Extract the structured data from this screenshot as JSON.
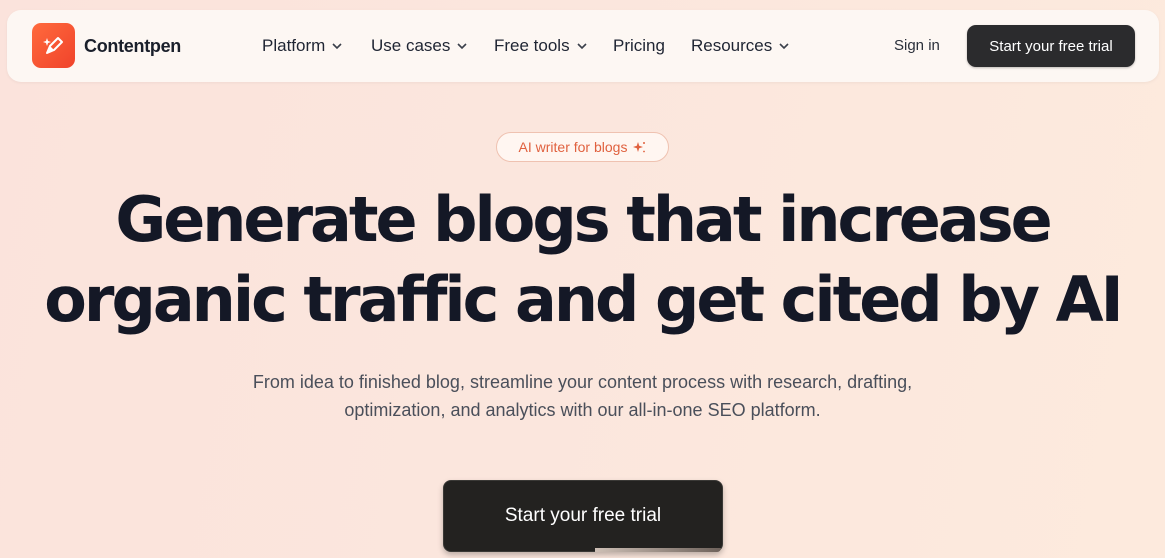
{
  "brand": {
    "name": "Contentpen",
    "logo_icon": "pen-sparkle-icon",
    "accent": "#f0432b"
  },
  "nav": {
    "items": [
      {
        "label": "Platform",
        "has_dropdown": true
      },
      {
        "label": "Use cases",
        "has_dropdown": true
      },
      {
        "label": "Free tools",
        "has_dropdown": true
      },
      {
        "label": "Pricing",
        "has_dropdown": false
      },
      {
        "label": "Resources",
        "has_dropdown": true
      }
    ],
    "sign_in": "Sign in",
    "cta": "Start your free trial"
  },
  "hero": {
    "badge": "AI writer for blogs",
    "badge_icon": "sparkle-icon",
    "headline_line1": "Generate blogs that increase",
    "headline_line2": "organic traffic and get cited by AI",
    "subtext_line1": "From idea to finished blog, streamline your content process with research, drafting,",
    "subtext_line2": "optimization, and analytics with our all-in-one SEO platform.",
    "cta": "Start your free trial"
  }
}
